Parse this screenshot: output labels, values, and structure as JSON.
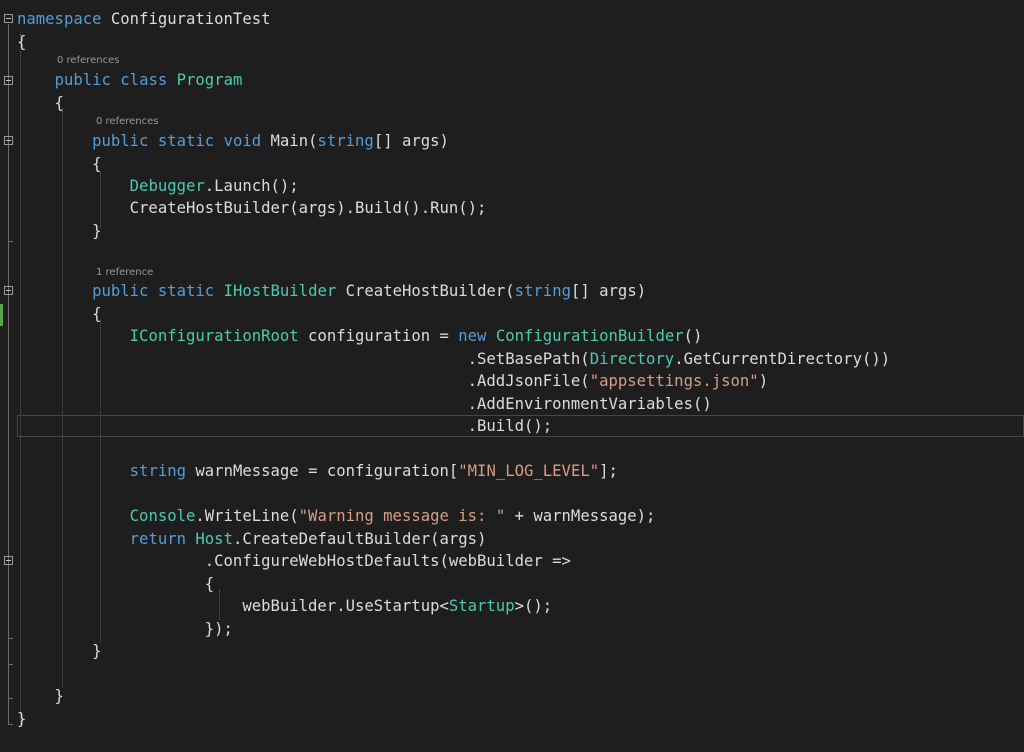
{
  "colors": {
    "background": "#1e1e1e",
    "keyword": "#569cd6",
    "type": "#4ec9b0",
    "text": "#dcdcdc",
    "string": "#d69d85",
    "codelens": "#999999"
  },
  "codelens": {
    "class_refs": "0 references",
    "main_refs": "0 references",
    "builder_refs": "1 reference"
  },
  "lines": [
    [
      {
        "c": "kw",
        "t": "namespace"
      },
      {
        "c": "tx",
        "t": " ConfigurationTest"
      }
    ],
    [
      {
        "c": "tx",
        "t": "{"
      }
    ],
    [
      {
        "c": "tx",
        "t": "    "
      },
      {
        "c": "kw",
        "t": "public"
      },
      {
        "c": "tx",
        "t": " "
      },
      {
        "c": "kw",
        "t": "class"
      },
      {
        "c": "tx",
        "t": " "
      },
      {
        "c": "ty",
        "t": "Program"
      }
    ],
    [
      {
        "c": "tx",
        "t": "    {"
      }
    ],
    [
      {
        "c": "tx",
        "t": "        "
      },
      {
        "c": "kw",
        "t": "public"
      },
      {
        "c": "tx",
        "t": " "
      },
      {
        "c": "kw",
        "t": "static"
      },
      {
        "c": "tx",
        "t": " "
      },
      {
        "c": "kw",
        "t": "void"
      },
      {
        "c": "tx",
        "t": " Main("
      },
      {
        "c": "kw",
        "t": "string"
      },
      {
        "c": "tx",
        "t": "[] args)"
      }
    ],
    [
      {
        "c": "tx",
        "t": "        {"
      }
    ],
    [
      {
        "c": "tx",
        "t": "            "
      },
      {
        "c": "ty",
        "t": "Debugger"
      },
      {
        "c": "tx",
        "t": ".Launch();"
      }
    ],
    [
      {
        "c": "tx",
        "t": "            CreateHostBuilder(args).Build().Run();"
      }
    ],
    [
      {
        "c": "tx",
        "t": "        }"
      }
    ],
    [
      {
        "c": "tx",
        "t": ""
      }
    ],
    [
      {
        "c": "tx",
        "t": "        "
      },
      {
        "c": "kw",
        "t": "public"
      },
      {
        "c": "tx",
        "t": " "
      },
      {
        "c": "kw",
        "t": "static"
      },
      {
        "c": "tx",
        "t": " "
      },
      {
        "c": "ty",
        "t": "IHostBuilder"
      },
      {
        "c": "tx",
        "t": " CreateHostBuilder("
      },
      {
        "c": "kw",
        "t": "string"
      },
      {
        "c": "tx",
        "t": "[] args)"
      }
    ],
    [
      {
        "c": "tx",
        "t": "        {"
      }
    ],
    [
      {
        "c": "tx",
        "t": "            "
      },
      {
        "c": "ty",
        "t": "IConfigurationRoot"
      },
      {
        "c": "tx",
        "t": " configuration = "
      },
      {
        "c": "kw",
        "t": "new"
      },
      {
        "c": "tx",
        "t": " "
      },
      {
        "c": "ty",
        "t": "ConfigurationBuilder"
      },
      {
        "c": "tx",
        "t": "()"
      }
    ],
    [
      {
        "c": "tx",
        "t": "                                                .SetBasePath("
      },
      {
        "c": "ty",
        "t": "Directory"
      },
      {
        "c": "tx",
        "t": ".GetCurrentDirectory())"
      }
    ],
    [
      {
        "c": "tx",
        "t": "                                                .AddJsonFile("
      },
      {
        "c": "st",
        "t": "\"appsettings.json\""
      },
      {
        "c": "tx",
        "t": ")"
      }
    ],
    [
      {
        "c": "tx",
        "t": "                                                .AddEnvironmentVariables()"
      }
    ],
    [
      {
        "c": "tx",
        "t": "                                                .Build();"
      }
    ],
    [
      {
        "c": "tx",
        "t": ""
      }
    ],
    [
      {
        "c": "tx",
        "t": "            "
      },
      {
        "c": "kw",
        "t": "string"
      },
      {
        "c": "tx",
        "t": " warnMessage = configuration["
      },
      {
        "c": "st",
        "t": "\"MIN_LOG_LEVEL\""
      },
      {
        "c": "tx",
        "t": "];"
      }
    ],
    [
      {
        "c": "tx",
        "t": ""
      }
    ],
    [
      {
        "c": "tx",
        "t": "            "
      },
      {
        "c": "ty",
        "t": "Console"
      },
      {
        "c": "tx",
        "t": ".WriteLine("
      },
      {
        "c": "st",
        "t": "\"Warning message is: \""
      },
      {
        "c": "tx",
        "t": " + warnMessage);"
      }
    ],
    [
      {
        "c": "tx",
        "t": "            "
      },
      {
        "c": "kw",
        "t": "return"
      },
      {
        "c": "tx",
        "t": " "
      },
      {
        "c": "ty",
        "t": "Host"
      },
      {
        "c": "tx",
        "t": ".CreateDefaultBuilder(args)"
      }
    ],
    [
      {
        "c": "tx",
        "t": "                    .ConfigureWebHostDefaults(webBuilder =>"
      }
    ],
    [
      {
        "c": "tx",
        "t": "                    {"
      }
    ],
    [
      {
        "c": "tx",
        "t": "                        webBuilder.UseStartup<"
      },
      {
        "c": "ty",
        "t": "Startup"
      },
      {
        "c": "tx",
        "t": ">();"
      }
    ],
    [
      {
        "c": "tx",
        "t": "                    });"
      }
    ],
    [
      {
        "c": "tx",
        "t": "        }"
      }
    ],
    [
      {
        "c": "tx",
        "t": ""
      }
    ],
    [
      {
        "c": "tx",
        "t": "    }"
      }
    ],
    [
      {
        "c": "tx",
        "t": "}"
      }
    ]
  ]
}
